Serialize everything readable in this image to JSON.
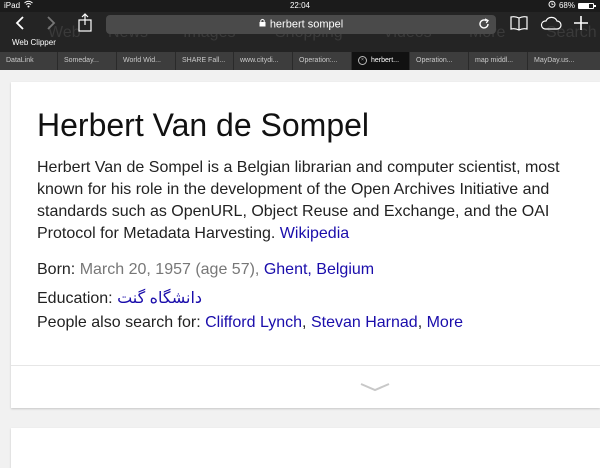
{
  "status_bar": {
    "device": "iPad",
    "time": "22:04",
    "battery_text": "68%",
    "battery_level": 0.68
  },
  "toolbar": {
    "url_text": "herbert sompel",
    "web_clipper_label": "Web Clipper",
    "background_nav_labels": [
      "Web",
      "News",
      "Images",
      "Shopping",
      "Videos",
      "More",
      "Search"
    ]
  },
  "tabs": [
    {
      "label": "DataLink",
      "active": false
    },
    {
      "label": "Someday...",
      "active": false
    },
    {
      "label": "World Wid...",
      "active": false
    },
    {
      "label": "SHARE Fall...",
      "active": false
    },
    {
      "label": "www.citydi...",
      "active": false
    },
    {
      "label": "Operation:...",
      "active": false
    },
    {
      "label": "herbert...",
      "active": true
    },
    {
      "label": "Operation...",
      "active": false
    },
    {
      "label": "map middl...",
      "active": false
    },
    {
      "label": "MayDay.us...",
      "active": false
    }
  ],
  "knowledge_panel": {
    "title": "Herbert Van de Sompel",
    "description": "Herbert Van de Sompel is a Belgian librarian and computer scientist, most known for his role in the development of the Open Archives Initiative and standards such as OpenURL, Object Reuse and Exchange, and the OAI Protocol for Metadata Harvesting.",
    "source_link": "Wikipedia",
    "born_label": "Born:",
    "born_value": "March 20, 1957 (age 57),",
    "born_place": "Ghent, Belgium",
    "education_label": "Education:",
    "education_value": "دانشگاه گنت",
    "also_search_label": "People also search for:",
    "also_search_1": "Clifford Lynch",
    "also_search_sep": ",",
    "also_search_2": "Stevan Harnad",
    "also_search_more": "More"
  },
  "colors": {
    "link": "#1a0dab",
    "toolbar": "#242424",
    "tabstrip": "#3d3d3d",
    "page_bg": "#f1f1f1"
  }
}
